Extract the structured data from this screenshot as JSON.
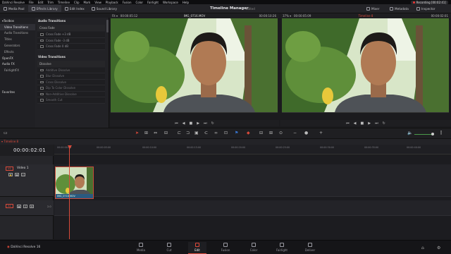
{
  "menubar": {
    "items": [
      "DaVinci Resolve",
      "File",
      "Edit",
      "Trim",
      "Timeline",
      "Clip",
      "Mark",
      "View",
      "Playback",
      "Fusion",
      "Color",
      "Fairlight",
      "Workspace",
      "Help"
    ],
    "recording": "Recording [00:02:41]"
  },
  "toolbar": {
    "media_pool": "Media Pool",
    "effects_library": "Effects Library",
    "edit_index": "Edit Index",
    "sound_library": "Sound Library",
    "title": "Timeline Manager",
    "subtitle": "Edited",
    "mixer": "Mixer",
    "metadata": "Metadata",
    "inspector": "Inspector"
  },
  "fxtree": {
    "toolbox": "Toolbox",
    "items": [
      "Video Transitions",
      "Audio Transitions",
      "Titles",
      "Generators",
      "Effects"
    ],
    "openfx": "OpenFX",
    "audiofx": "Audio FX",
    "fairlightfx": "FairlightFX",
    "favorites": "Favorites"
  },
  "fxlist": {
    "audio_header": "Audio Transitions",
    "crossfade_header": "Cross Fade",
    "audio_items": [
      "Cross Fade +3 dB",
      "Cross Fade -3 dB",
      "Cross Fade 0 dB"
    ],
    "video_header": "Video Transitions",
    "dissolve_header": "Dissolve",
    "video_items": [
      "Additive Dissolve",
      "Blur Dissolve",
      "Cross Dissolve",
      "Dip To Color Dissolve",
      "Non-Additive Dissolve",
      "Smooth Cut"
    ]
  },
  "source_viewer": {
    "zoom": "Fit",
    "timecode": "00:00:05:12",
    "clip": "IMG_0716.MOV",
    "end_timecode": "00:00:10:26"
  },
  "timeline_viewer": {
    "zoom": "37%",
    "timecode": "00:00:05:09",
    "timeline": "Timeline 8",
    "end_timecode": "00:00:02:01"
  },
  "timeline": {
    "tab": "Timeline 8",
    "timecode": "00:00:02:01",
    "ruler": [
      "00:00:00:00",
      "00:00:05:00",
      "00:00:10:00",
      "00:00:15:00",
      "00:00:20:00",
      "00:00:25:00",
      "00:00:30:00",
      "00:00:35:00",
      "00:00:40:00",
      "00:00:45:00",
      "00:00:50:00"
    ],
    "video_track": {
      "badge": "V1",
      "name": "Video 1"
    },
    "audio_track": {
      "badge": "A1",
      "s": "S",
      "m": "M",
      "level": "2.0"
    },
    "clip_name": "IMG_0716.MOV"
  },
  "statusbar": {
    "app": "DaVinci Resolve 16",
    "pages": [
      "Media",
      "Cut",
      "Edit",
      "Fusion",
      "Color",
      "Fairlight",
      "Deliver"
    ],
    "selected_page": "Edit"
  }
}
